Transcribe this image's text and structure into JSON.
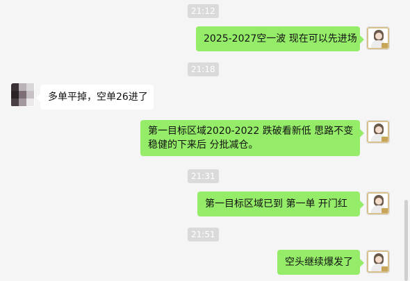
{
  "messages": [
    {
      "time": "21:12",
      "text": "2025-2027空一波 现在可以先进场"
    },
    {
      "time": "21:18",
      "text": "多单平掉，空单26进了"
    },
    {
      "text_line1": "第一目标区域2020-2022  跌破看新低 思路不变",
      "text_line2": "稳健的下来后 分批减仓。"
    },
    {
      "time": "21:31",
      "text": "第一目标区域已到    第一单 开门红"
    },
    {
      "time": "21:51",
      "text": "空头继续爆发了"
    }
  ],
  "avatars": {
    "self": "woman-avatar-icon",
    "other": "mosaic-avatar-icon"
  },
  "colors": {
    "outgoing_bubble": "#95ec69",
    "incoming_bubble": "#ffffff",
    "background": "#f5f5f5",
    "timestamp": "#dadada"
  }
}
